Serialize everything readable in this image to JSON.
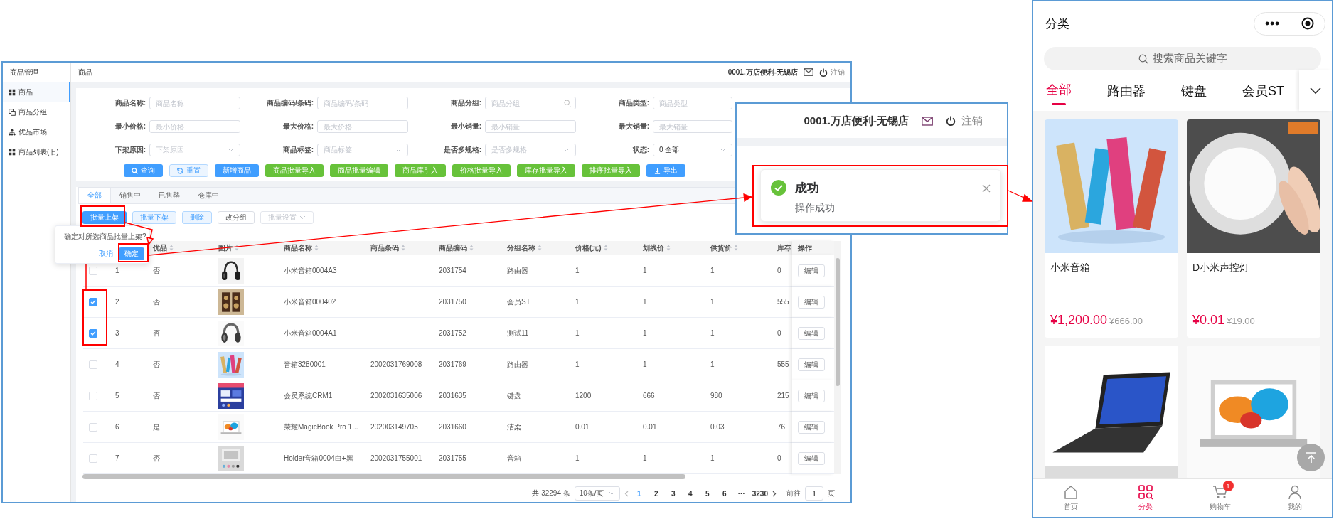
{
  "admin": {
    "sidebar": {
      "title": "商品管理",
      "items": [
        {
          "label": "商品",
          "selected": true
        },
        {
          "label": "商品分组",
          "selected": false
        },
        {
          "label": "优品市场",
          "selected": false
        },
        {
          "label": "商品列表(旧)",
          "selected": false
        }
      ]
    },
    "header": {
      "breadcrumb": "商品",
      "store": "0001.万店便利-无锡店",
      "logout": "注销"
    },
    "filters": [
      {
        "label": "商品名称:",
        "kind": "input",
        "placeholder": "商品名称"
      },
      {
        "label": "商品编码/条码:",
        "kind": "input",
        "placeholder": "商品编码/条码"
      },
      {
        "label": "商品分组:",
        "kind": "search",
        "placeholder": "商品分组"
      },
      {
        "label": "商品类型:",
        "kind": "input",
        "placeholder": "商品类型"
      },
      {
        "label": "最小价格:",
        "kind": "input",
        "placeholder": "最小价格"
      },
      {
        "label": "最大价格:",
        "kind": "input",
        "placeholder": "最大价格"
      },
      {
        "label": "最小销量:",
        "kind": "input",
        "placeholder": "最小销量"
      },
      {
        "label": "最大销量:",
        "kind": "input",
        "placeholder": "最大销量"
      },
      {
        "label": "下架原因:",
        "kind": "select",
        "placeholder": "下架原因"
      },
      {
        "label": "商品标签:",
        "kind": "select",
        "placeholder": "商品标签"
      },
      {
        "label": "是否多规格:",
        "kind": "select",
        "placeholder": "是否多规格"
      },
      {
        "label": "状态:",
        "kind": "select",
        "value": "0 全部"
      }
    ],
    "filter_buttons": [
      {
        "label": "查询",
        "kind": "search"
      },
      {
        "label": "重置",
        "kind": "reset"
      },
      {
        "label": "新增商品",
        "kind": "primary"
      },
      {
        "label": "商品批量导入",
        "kind": "success"
      },
      {
        "label": "商品批量编辑",
        "kind": "success"
      },
      {
        "label": "商品库引入",
        "kind": "success"
      },
      {
        "label": "价格批量导入",
        "kind": "success"
      },
      {
        "label": "库存批量导入",
        "kind": "success"
      },
      {
        "label": "排序批量导入",
        "kind": "success"
      },
      {
        "label": "导出",
        "kind": "export"
      }
    ],
    "tabs": [
      {
        "label": "全部",
        "selected": true
      },
      {
        "label": "销售中",
        "selected": false
      },
      {
        "label": "已售罄",
        "selected": false
      },
      {
        "label": "仓库中",
        "selected": false
      }
    ],
    "actions": [
      {
        "label": "批量上架",
        "kind": "primary",
        "disabled": false
      },
      {
        "label": "批量下架",
        "kind": "light",
        "disabled": false
      },
      {
        "label": "删除",
        "kind": "light",
        "disabled": false
      },
      {
        "label": "改分组",
        "kind": "plain",
        "disabled": false
      },
      {
        "label": "批量设置",
        "kind": "dropdown",
        "disabled": true
      }
    ],
    "table": {
      "columns": [
        {
          "label": "优品",
          "sortable": true
        },
        {
          "label": "图片",
          "sortable": true
        },
        {
          "label": "商品名称",
          "sortable": true
        },
        {
          "label": "商品条码",
          "sortable": true
        },
        {
          "label": "商品编码",
          "sortable": true
        },
        {
          "label": "分组名称",
          "sortable": true
        },
        {
          "label": "价格(元)",
          "sortable": true
        },
        {
          "label": "划线价",
          "sortable": true
        },
        {
          "label": "供货价",
          "sortable": true
        },
        {
          "label": "库存"
        },
        {
          "label": "操作"
        }
      ],
      "rows": [
        {
          "checked": false,
          "index": "1",
          "featured": "否",
          "name": "小米音箱0004A3",
          "code": "2031754",
          "group": "路由器",
          "price": "1",
          "list_price": "1",
          "supply_price": "1",
          "stock": "0",
          "action": "编辑"
        },
        {
          "checked": true,
          "index": "2",
          "featured": "否",
          "name": "小米音箱000402",
          "code": "2031750",
          "group": "会员ST",
          "price": "1",
          "list_price": "1",
          "supply_price": "1",
          "stock": "555",
          "action": "编辑"
        },
        {
          "checked": true,
          "index": "3",
          "featured": "否",
          "name": "小米音箱0004A1",
          "code": "2031752",
          "group": "测试11",
          "price": "1",
          "list_price": "1",
          "supply_price": "1",
          "stock": "0",
          "action": "编辑"
        },
        {
          "checked": false,
          "index": "4",
          "featured": "否",
          "name": "音箱3280001",
          "barcode": "2002031769008",
          "code": "2031769",
          "group": "路由器",
          "price": "1",
          "list_price": "1",
          "supply_price": "1",
          "stock": "555",
          "action": "编辑"
        },
        {
          "checked": false,
          "index": "5",
          "featured": "否",
          "name": "会员系统CRM1",
          "barcode": "2002031635006",
          "code": "2031635",
          "group": "键盘",
          "price": "1200",
          "list_price": "666",
          "supply_price": "980",
          "stock": "215",
          "action": "编辑"
        },
        {
          "checked": false,
          "index": "6",
          "featured": "是",
          "name": "荣耀MagicBook Pro 1...",
          "barcode": "202003149705",
          "code": "2031660",
          "group": "洁柔",
          "price": "0.01",
          "list_price": "0.01",
          "supply_price": "0.03",
          "stock": "76",
          "action": "编辑"
        },
        {
          "checked": false,
          "index": "7",
          "featured": "否",
          "name": "Holder音箱0004白+黑",
          "barcode": "2002031755001",
          "code": "2031755",
          "group": "音箱",
          "price": "1",
          "list_price": "1",
          "supply_price": "1",
          "stock": "0",
          "action": "编辑"
        }
      ]
    },
    "pagination": {
      "total": "共 32294 条",
      "page_size": "10条/页",
      "pages": [
        {
          "label": "1",
          "selected": true
        },
        {
          "label": "2",
          "selected": false
        },
        {
          "label": "3",
          "selected": false
        },
        {
          "label": "4",
          "selected": false
        },
        {
          "label": "5",
          "selected": false
        },
        {
          "label": "6",
          "selected": false
        },
        {
          "label": "···",
          "selected": false
        },
        {
          "label": "3230",
          "selected": false
        }
      ],
      "goto": "前往",
      "goto_value": "1",
      "goto_suffix": "页"
    },
    "confirm": {
      "message": "确定对所选商品批量上架?",
      "cancel": "取消",
      "ok": "确定"
    }
  },
  "notice_inset": {
    "store": "0001.万店便利-无锡店",
    "logout": "注销",
    "title": "成功",
    "message": "操作成功"
  },
  "mobile": {
    "title": "分类",
    "search_placeholder": "搜索商品关键字",
    "tabs": [
      {
        "label": "全部",
        "selected": true
      },
      {
        "label": "路由器",
        "selected": false
      },
      {
        "label": "键盘",
        "selected": false
      },
      {
        "label": "会员ST",
        "selected": false
      }
    ],
    "products": [
      {
        "name": "小米音箱",
        "price": "¥1,200.00",
        "original_price": "¥666.00"
      },
      {
        "name": "D小米声控灯",
        "price": "¥0.01",
        "original_price": "¥19.00"
      },
      {
        "kind": "picture"
      },
      {
        "kind": "picture"
      }
    ],
    "tab_bar": [
      {
        "label": "首页",
        "selected": false
      },
      {
        "label": "分类",
        "selected": true
      },
      {
        "label": "购物车",
        "selected": false,
        "badge": "1"
      },
      {
        "label": "我的",
        "selected": false
      }
    ]
  }
}
